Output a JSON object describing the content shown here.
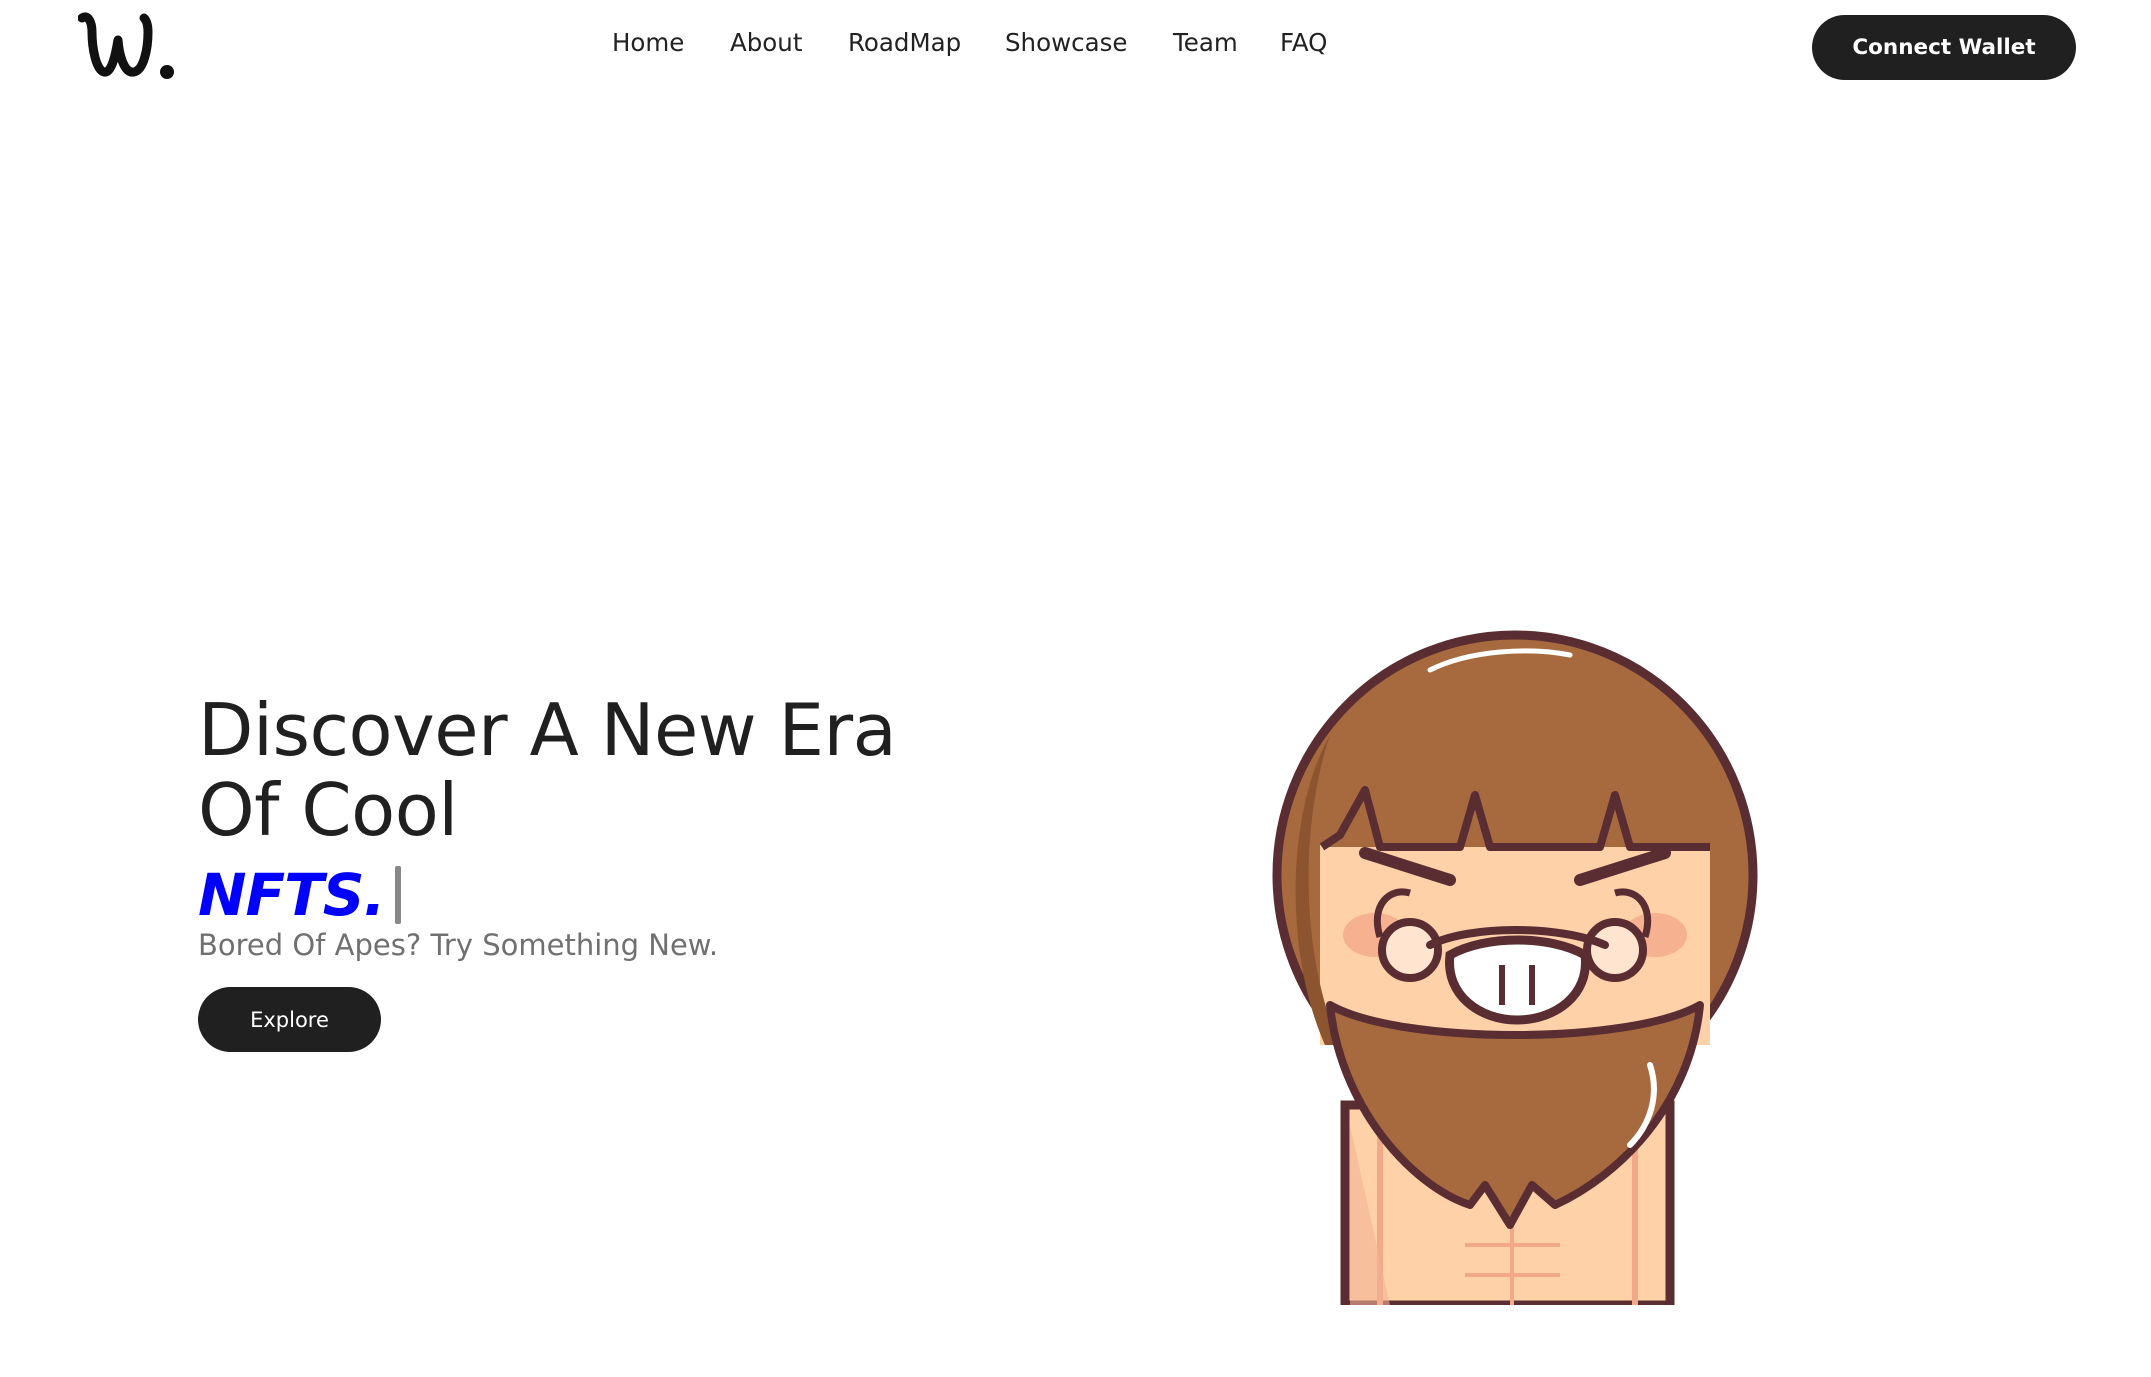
{
  "nav": {
    "logo_alt": "W.",
    "links": [
      {
        "label": "Home"
      },
      {
        "label": "About"
      },
      {
        "label": "RoadMap"
      },
      {
        "label": "Showcase"
      },
      {
        "label": "Team"
      },
      {
        "label": "FAQ"
      }
    ],
    "connect_label": "Connect Wallet"
  },
  "hero": {
    "title_line1": "Discover A New Era",
    "title_line2": "Of Cool",
    "typed_word": "NFTS.",
    "subtitle": "Bored Of Apes? Try Something New.",
    "explore_label": "Explore",
    "illustration": "bearded-cartoon-character"
  },
  "colors": {
    "primary_dark": "#202020",
    "accent_blue": "#0000ff",
    "subtitle_gray": "#707070",
    "background": "#ffffff"
  }
}
